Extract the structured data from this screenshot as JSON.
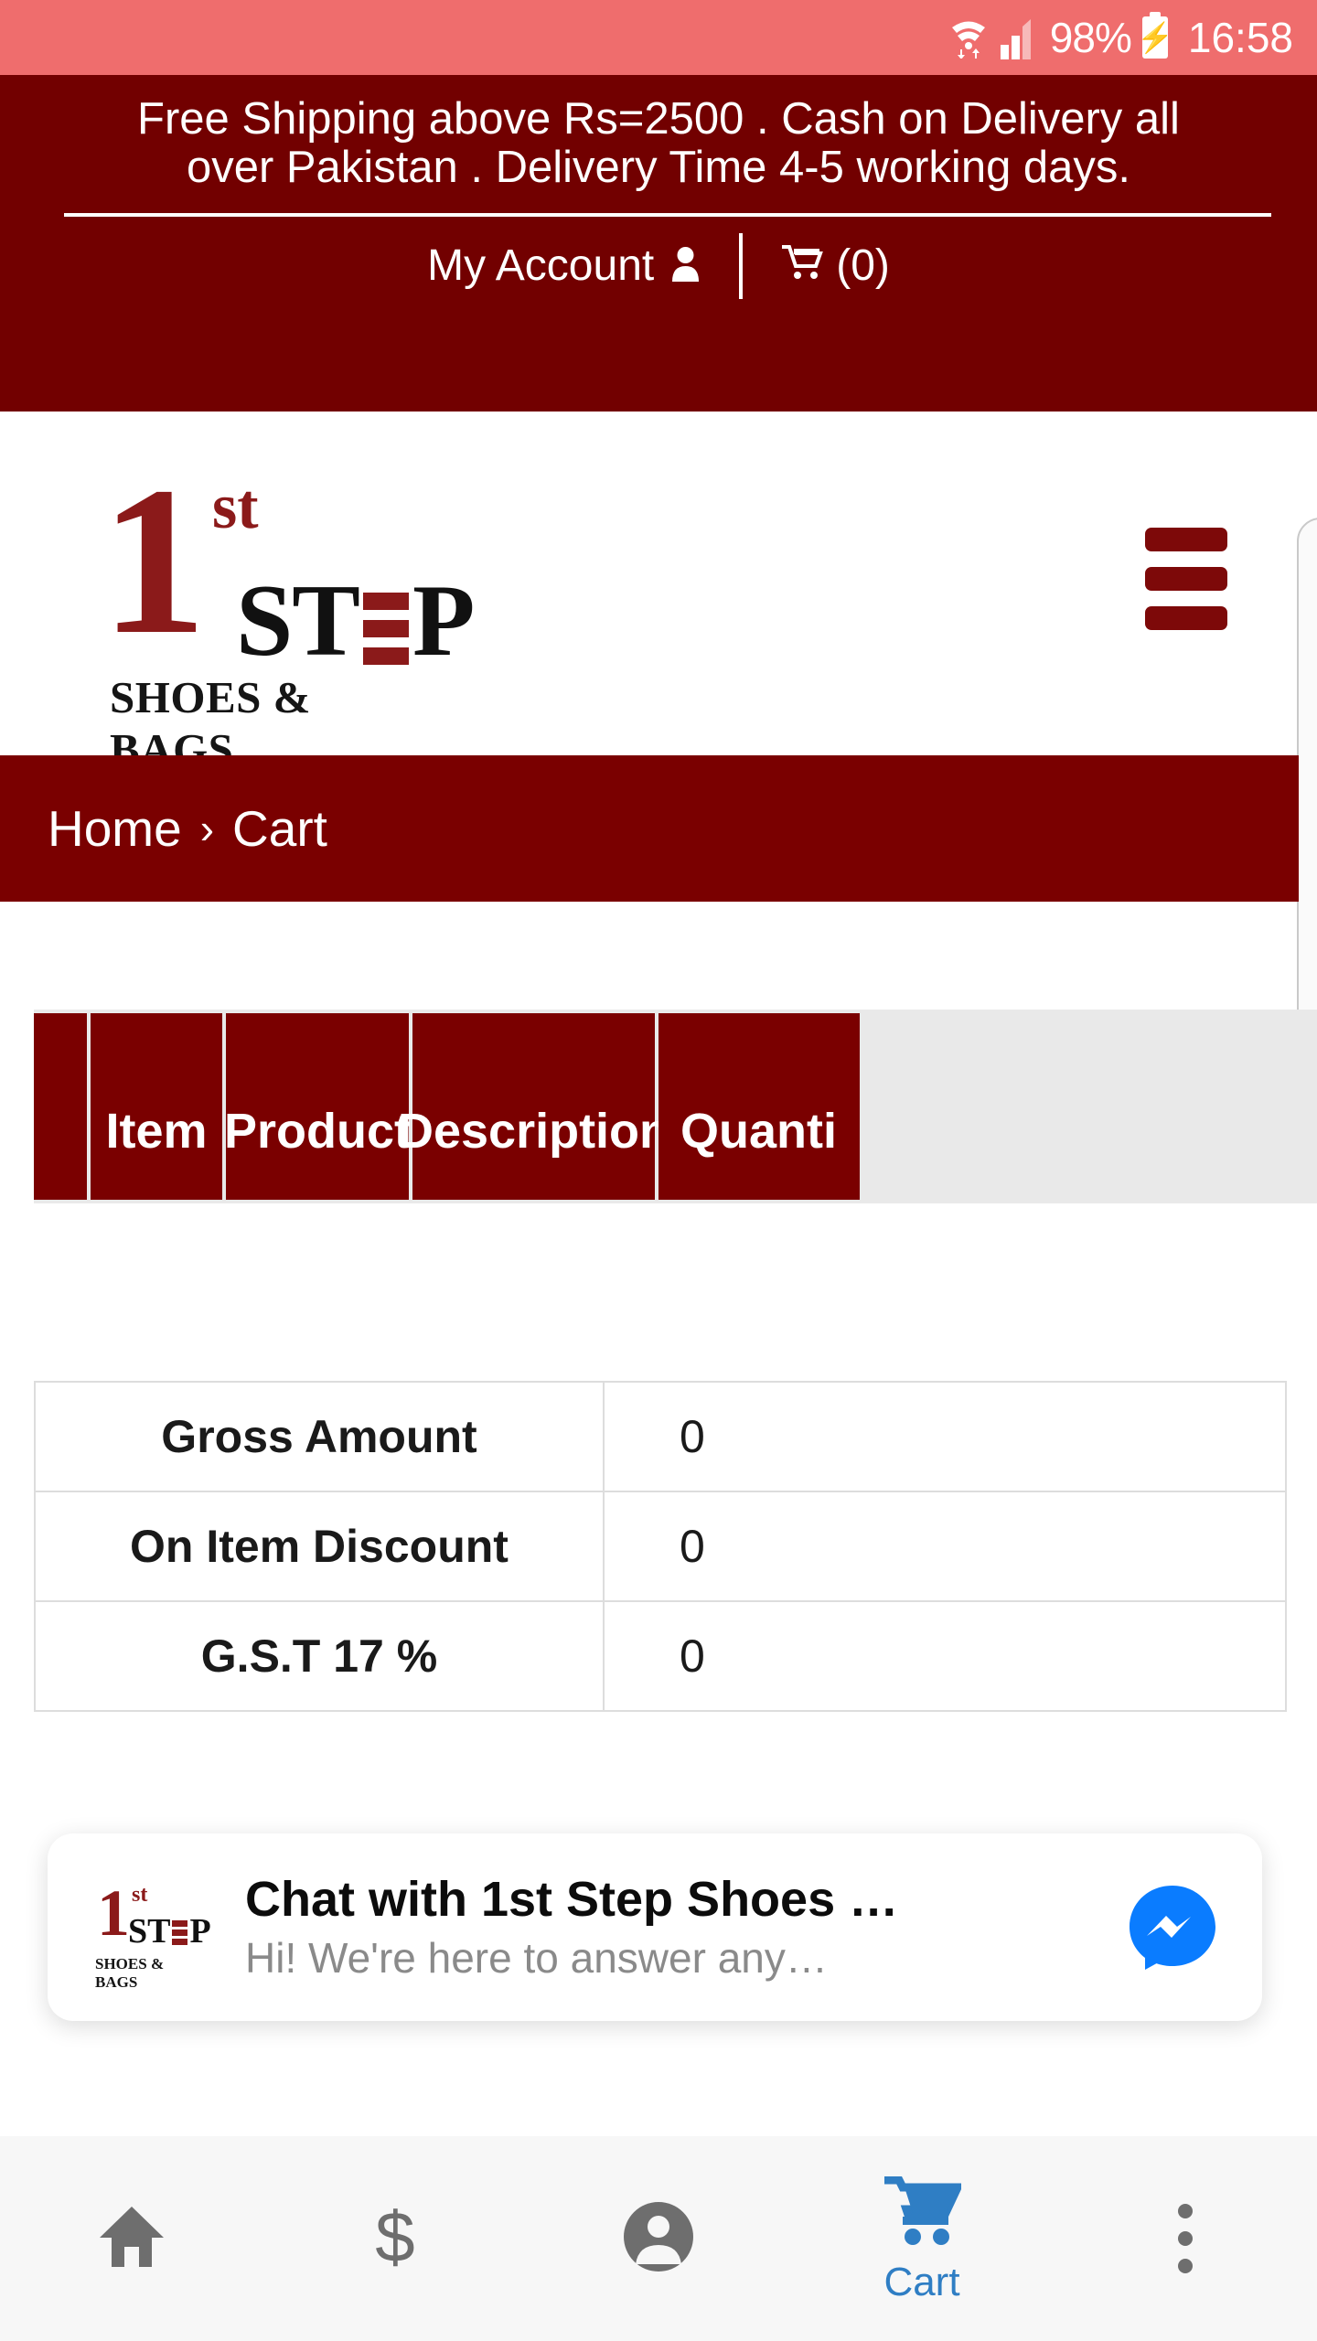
{
  "statusbar": {
    "battery_percent": "98%",
    "time": "16:58",
    "battery_bolt": "⚡",
    "bg_color": "#ef6d6d"
  },
  "promo": {
    "line1": "Free Shipping above Rs=2500 . Cash on Delivery all",
    "line2": "over Pakistan . Delivery Time 4-5 working days.",
    "bg_color": "#720000"
  },
  "topbar": {
    "account_label": "My Account",
    "account_icon": "person-icon",
    "cart_icon": "shopping-cart-icon",
    "cart_count": "(0)"
  },
  "logo": {
    "one": "1",
    "st": "st",
    "step_left": "ST",
    "step_right": "P",
    "subtitle": "SHOES & BAGS",
    "brand_red": "#8b1a1a"
  },
  "header": {
    "menu_icon": "hamburger-menu-icon"
  },
  "breadcrumb": {
    "home": "Home",
    "separator": "›",
    "current": "Cart",
    "bg_color": "#7a0000"
  },
  "cart_table": {
    "headers": [
      "",
      "Item",
      "Product",
      "Description",
      "Quanti"
    ],
    "header_bg": "#7a0000"
  },
  "summary": {
    "rows": [
      {
        "label": "Gross Amount",
        "value": "0"
      },
      {
        "label": "On Item Discount",
        "value": "0"
      },
      {
        "label": "G.S.T 17 %",
        "value": "0"
      }
    ]
  },
  "chat_widget": {
    "title": "Chat with 1st Step Shoes …",
    "subtitle": "Hi! We're here to answer any…",
    "messenger_icon": "messenger-icon",
    "messenger_color": "#0a7cff"
  },
  "bottom_nav": {
    "items": [
      {
        "icon": "home-icon",
        "label": "",
        "active": false
      },
      {
        "icon": "dollar-icon",
        "label": "",
        "active": false
      },
      {
        "icon": "account-circle-icon",
        "label": "",
        "active": false
      },
      {
        "icon": "shopping-cart-icon",
        "label": "Cart",
        "active": true
      },
      {
        "icon": "more-vertical-icon",
        "label": "",
        "active": false
      }
    ],
    "active_color": "#2f7ec4",
    "inactive_color": "#6e6e6e"
  }
}
